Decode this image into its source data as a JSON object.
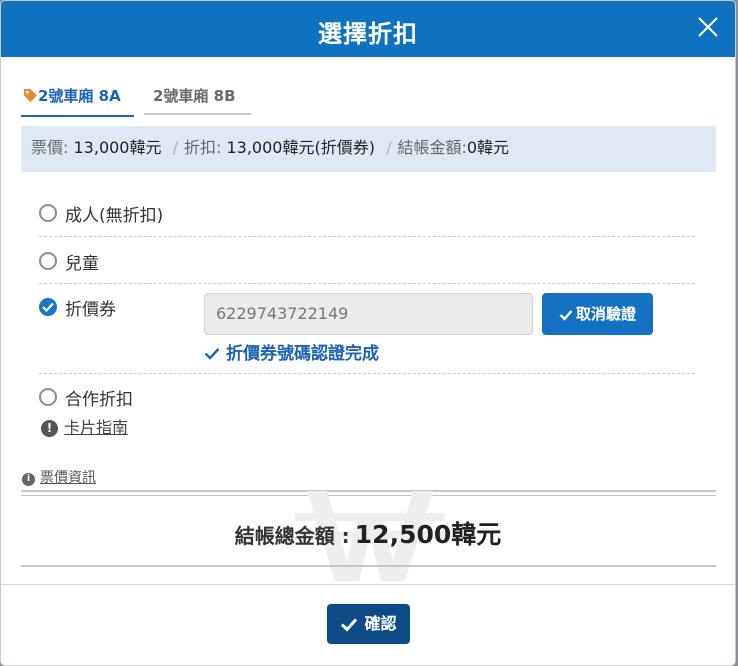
{
  "modal": {
    "title": "選擇折扣",
    "close_icon": "close-icon"
  },
  "tabs": [
    {
      "label": "2號車廂 8A",
      "active": true,
      "icon": "tag-icon"
    },
    {
      "label": "2號車廂 8B",
      "active": false
    }
  ],
  "summary": {
    "fare_label": "票價",
    "fare_value": "13,000韓元",
    "discount_label": "折扣",
    "discount_value": "13,000韓元(折價券)",
    "total_label": "結帳金額",
    "total_value": "0韓元",
    "separator": "/",
    "colon": ":"
  },
  "options": [
    {
      "label": "成人(無折扣)",
      "checked": false
    },
    {
      "label": "兒童",
      "checked": false
    },
    {
      "label": "折價券",
      "checked": true
    },
    {
      "label": "合作折扣",
      "checked": false
    }
  ],
  "voucher": {
    "code": "6229743722149",
    "cancel_button": "取消驗證",
    "verified_message": "折價券號碼認證完成"
  },
  "card_guide": {
    "label": "卡片指南",
    "icon_glyph": "!"
  },
  "fare_info": {
    "label": "票價資訊",
    "icon_glyph": "i"
  },
  "total": {
    "label": "結帳總金額 :",
    "value": "12,500韓元"
  },
  "confirm_button": "確認",
  "colors": {
    "header": "#0e72c0",
    "accent": "#1c64b3",
    "summary_bg": "#dfe9f5",
    "confirm": "#0d4b86"
  }
}
